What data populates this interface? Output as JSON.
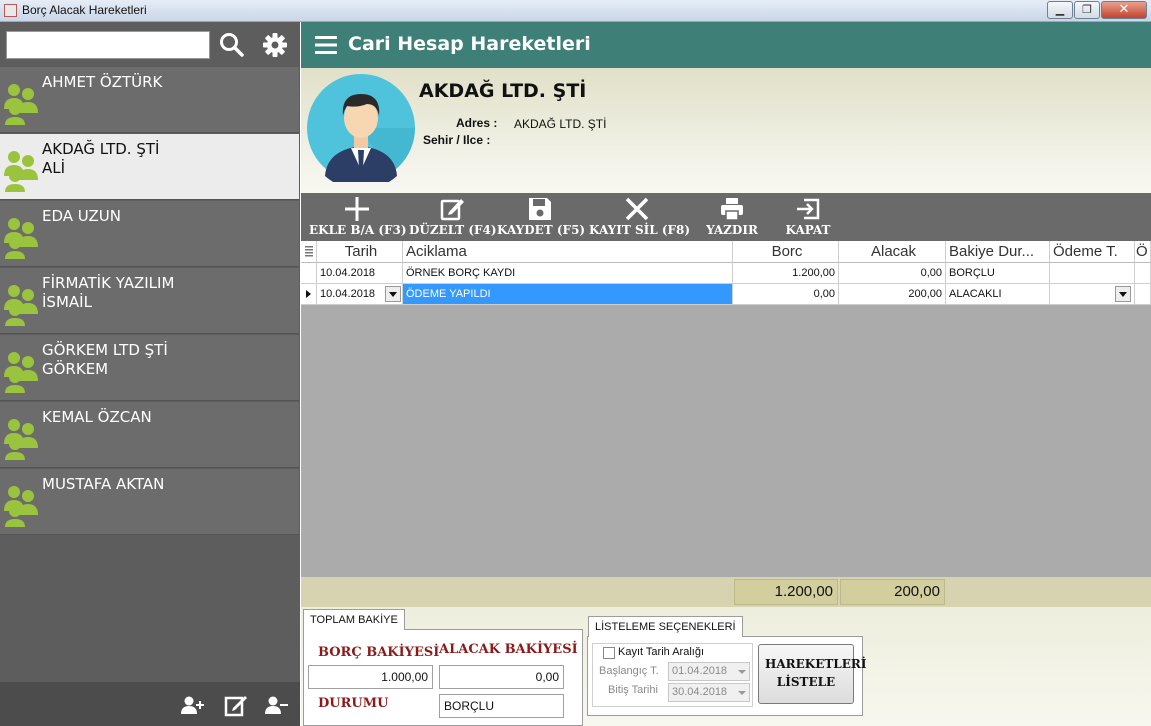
{
  "window": {
    "title": "Borç Alacak Hareketleri",
    "minimize": "▁",
    "maximize": "❐",
    "close": "✕"
  },
  "sidebar": {
    "search_value": "",
    "customers": [
      {
        "name": "AHMET ÖZTÜRK"
      },
      {
        "name": "AKDAĞ LTD. ŞTİ\nALİ",
        "selected": true
      },
      {
        "name": "EDA UZUN"
      },
      {
        "name": "FİRMATİK YAZILIM\nİSMAİL"
      },
      {
        "name": "GÖRKEM LTD ŞTİ\nGÖRKEM"
      },
      {
        "name": "KEMAL ÖZCAN"
      },
      {
        "name": "MUSTAFA AKTAN"
      }
    ]
  },
  "header": {
    "title": "Cari Hesap Hareketleri"
  },
  "info": {
    "company_name": "AKDAĞ LTD. ŞTİ",
    "address_label": "Adres :",
    "address_value": "AKDAĞ LTD. ŞTİ",
    "city_label": "Sehir / Ilce :",
    "city_value": ""
  },
  "toolbar": {
    "add_label": "EKLE B/A (F3)",
    "edit_label": "DÜZELT (F4)",
    "save_label": "KAYDET (F5)",
    "delete_label": "KAYIT SİL (F8)",
    "print_label": "YAZDIR",
    "close_label": "KAPAT"
  },
  "grid": {
    "columns": [
      "Tarih",
      "Aciklama",
      "Borc",
      "Alacak",
      "Bakiye Dur...",
      "Ödeme T.",
      "Ö"
    ],
    "rows": [
      {
        "date": "10.04.2018",
        "desc": "ÖRNEK BORÇ KAYDI",
        "borc": "1.200,00",
        "alacak": "0,00",
        "status": "BORÇLU",
        "odeme": ""
      },
      {
        "date": "10.04.2018",
        "desc": "ÖDEME YAPILDI",
        "borc": "0,00",
        "alacak": "200,00",
        "status": "ALACAKLI",
        "odeme": ""
      }
    ],
    "totals": {
      "borc": "1.200,00",
      "alacak": "200,00"
    }
  },
  "balance": {
    "tab_label": "TOPLAM BAKİYE",
    "borc_label": "BORÇ BAKİYESİ",
    "alacak_label": "ALACAK BAKİYESİ",
    "borc_value": "1.000,00",
    "alacak_value": "0,00",
    "status_label": "DURUMU",
    "status_value": "BORÇLU"
  },
  "listing": {
    "tab_label": "LİSTELEME SEÇENEKLERİ",
    "date_range_label": "Kayıt Tarih Aralığı",
    "start_label": "Başlangıç T.",
    "start_value": "01.04.2018",
    "end_label": "Bitiş Tarihi",
    "end_value": "30.04.2018",
    "list_button": "HAREKETLERİ LİSTELE"
  },
  "colors": {
    "header": "#3e7f77",
    "sidebar": "#5d5d5d",
    "selection": "#3399ff",
    "label_red": "#8c1a1a"
  }
}
